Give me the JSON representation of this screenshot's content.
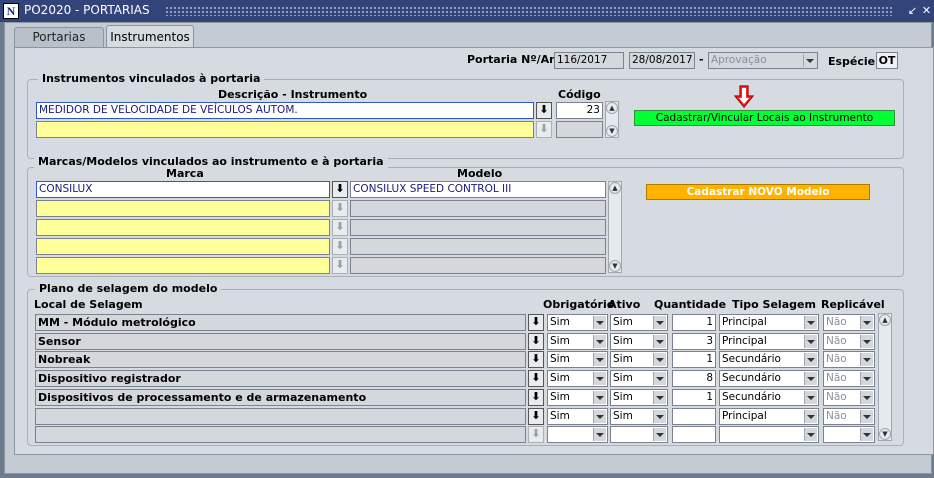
{
  "window": {
    "title": "PO2020 - PORTARIAS",
    "icon_letter": "N"
  },
  "tabs": [
    {
      "label": "Portarias"
    },
    {
      "label": "Instrumentos"
    }
  ],
  "header": {
    "portaria_label": "Portaria Nº/Ano",
    "portaria_value": "116/2017",
    "date_value": "28/08/2017",
    "dash": "-",
    "status_value": "Aprovação",
    "especie_label": "Espécie",
    "especie_value": "OT"
  },
  "instrumentos": {
    "title": "Instrumentos vinculados à portaria",
    "col_descricao": "Descrição - Instrumento",
    "col_codigo": "Código",
    "rows": [
      {
        "descricao": "MEDIDOR DE VELOCIDADE DE VEÍCULOS AUTOM.",
        "codigo": "23"
      },
      {
        "descricao": "",
        "codigo": ""
      }
    ],
    "button_label": "Cadastrar/Vincular Locais ao Instrumento",
    "button_color": "#00ff33"
  },
  "marcas": {
    "title": "Marcas/Modelos vinculados ao instrumento e à portaria",
    "col_marca": "Marca",
    "col_modelo": "Modelo",
    "rows": [
      {
        "marca": "CONSILUX",
        "modelo": "CONSILUX SPEED CONTROL III"
      },
      {
        "marca": "",
        "modelo": ""
      },
      {
        "marca": "",
        "modelo": ""
      },
      {
        "marca": "",
        "modelo": ""
      },
      {
        "marca": "",
        "modelo": ""
      }
    ],
    "button_label": "Cadastrar NOVO Modelo",
    "button_color": "#ffb300"
  },
  "plano": {
    "title": "Plano de selagem do modelo",
    "col_local": "Local de Selagem",
    "col_obrigatorio": "Obrigatório",
    "col_ativo": "Ativo",
    "col_quantidade": "Quantidade",
    "col_tipo": "Tipo Selagem",
    "col_replicavel": "Replicável",
    "rows": [
      {
        "local": "MM - Módulo metrológico",
        "obrigatorio": "Sim",
        "ativo": "Sim",
        "quantidade": "1",
        "tipo": "Principal",
        "replicavel": "Não"
      },
      {
        "local": "Sensor",
        "obrigatorio": "Sim",
        "ativo": "Sim",
        "quantidade": "3",
        "tipo": "Principal",
        "replicavel": "Não"
      },
      {
        "local": "Nobreak",
        "obrigatorio": "Sim",
        "ativo": "Sim",
        "quantidade": "1",
        "tipo": "Secundário",
        "replicavel": "Não"
      },
      {
        "local": "Dispositivo registrador",
        "obrigatorio": "Sim",
        "ativo": "Sim",
        "quantidade": "8",
        "tipo": "Secundário",
        "replicavel": "Não"
      },
      {
        "local": "Dispositivos de processamento e de armazenamento",
        "obrigatorio": "Sim",
        "ativo": "Sim",
        "quantidade": "1",
        "tipo": "Secundário",
        "replicavel": "Não"
      },
      {
        "local": "",
        "obrigatorio": "Sim",
        "ativo": "Sim",
        "quantidade": "",
        "tipo": "Principal",
        "replicavel": "Não"
      },
      {
        "local": "",
        "obrigatorio": "",
        "ativo": "",
        "quantidade": "",
        "tipo": "",
        "replicavel": ""
      }
    ]
  },
  "icons": {
    "lov": "download-arrow-icon",
    "red_arrow": "red-down-arrow-icon"
  }
}
